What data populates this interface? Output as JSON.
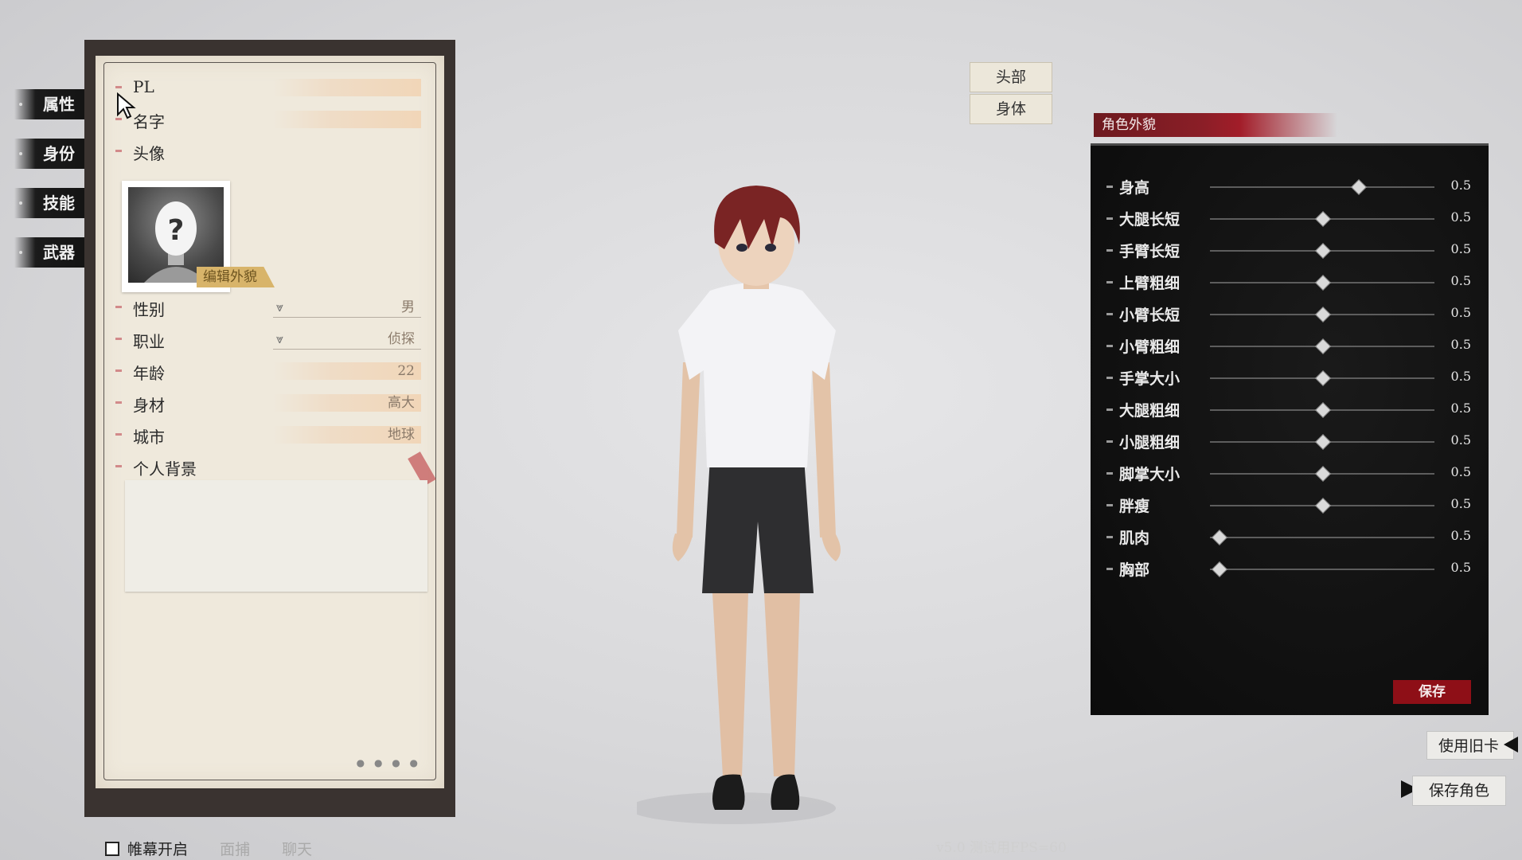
{
  "side_tabs": [
    "属性",
    "身份",
    "技能",
    "武器"
  ],
  "profile": {
    "pl_label": "PL",
    "name_label": "名字",
    "avatar_label": "头像",
    "edit_appearance": "编辑外貌",
    "gender_label": "性别",
    "gender_value": "男",
    "job_label": "职业",
    "job_value": "侦探",
    "age_label": "年龄",
    "age_value": "22",
    "body_label": "身材",
    "body_value": "高大",
    "city_label": "城市",
    "city_value": "地球",
    "background_label": "个人背景"
  },
  "part_tabs": [
    "头部",
    "身体"
  ],
  "appearance": {
    "title": "角色外貌",
    "save_label": "保存",
    "sliders": [
      {
        "label": "身高",
        "value": "0.5",
        "level": 0.66
      },
      {
        "label": "大腿长短",
        "value": "0.5",
        "level": 0.5
      },
      {
        "label": "手臂长短",
        "value": "0.5",
        "level": 0.5
      },
      {
        "label": "上臂粗细",
        "value": "0.5",
        "level": 0.5
      },
      {
        "label": "小臂长短",
        "value": "0.5",
        "level": 0.5
      },
      {
        "label": "小臂粗细",
        "value": "0.5",
        "level": 0.5
      },
      {
        "label": "手掌大小",
        "value": "0.5",
        "level": 0.5
      },
      {
        "label": "大腿粗细",
        "value": "0.5",
        "level": 0.5
      },
      {
        "label": "小腿粗细",
        "value": "0.5",
        "level": 0.5
      },
      {
        "label": "脚掌大小",
        "value": "0.5",
        "level": 0.5
      },
      {
        "label": "胖瘦",
        "value": "0.5",
        "level": 0.5
      },
      {
        "label": "肌肉",
        "value": "0.5",
        "level": 0.04
      },
      {
        "label": "胸部",
        "value": "0.5",
        "level": 0.04
      }
    ]
  },
  "actions": {
    "use_old_card": "使用旧卡",
    "save_character": "保存角色"
  },
  "bottom": {
    "curtain": "帷幕开启",
    "face_capture": "面捕",
    "chat": "聊天"
  },
  "version": "v5.0 测试用FPS=60"
}
